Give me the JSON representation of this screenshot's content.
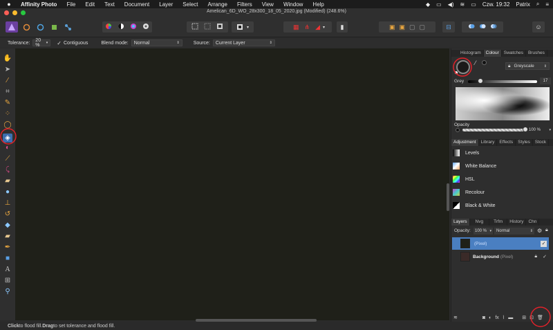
{
  "menubar": {
    "app_name": "Affinity Photo",
    "items": [
      "File",
      "Edit",
      "Text",
      "Document",
      "Layer",
      "Select",
      "Arrange",
      "Filters",
      "View",
      "Window",
      "Help"
    ],
    "clock": "Czw. 19:32",
    "user": "Patrix"
  },
  "window": {
    "title": "Amelican_6D_WO_28x300_18_05_2020.jpg (Modified) (248.6%)"
  },
  "context": {
    "tolerance_label": "Tolerance:",
    "tolerance_value": "20 %",
    "contiguous_label": "Contiguous",
    "blend_label": "Blend mode:",
    "blend_value": "Normal",
    "source_label": "Source:",
    "source_value": "Current Layer"
  },
  "colour_panel": {
    "tabs": [
      "Histogram",
      "Colour",
      "Swatches",
      "Brushes"
    ],
    "mode": "Greyscale",
    "grey_label": "Grey",
    "grey_value": "17",
    "opacity_label": "Opacity",
    "opacity_value": "100 %"
  },
  "adjustment_panel": {
    "tabs": [
      "Adjustment",
      "Library",
      "Effects",
      "Styles",
      "Stock"
    ],
    "items": [
      "Levels",
      "White Balance",
      "HSL",
      "Recolour",
      "Black & White"
    ]
  },
  "layers_panel": {
    "tabs": [
      "Layers",
      "Nvg",
      "Trfm",
      "History",
      "Chn"
    ],
    "opacity_label": "Opacity:",
    "opacity_value": "100 %",
    "blend_value": "Normal",
    "layers": [
      {
        "name": "",
        "type": "(Pixel)"
      },
      {
        "name": "Background",
        "type": "(Pixel)"
      }
    ]
  },
  "status": {
    "text_click": "Click",
    "text_a": " to flood fill. ",
    "text_drag": "Drag",
    "text_b": " to set tolerance and flood fill."
  },
  "colors": {
    "canvas": "#1f2019",
    "selected_layer": "#4a7fc1",
    "annotation_red": "#e0222a"
  }
}
